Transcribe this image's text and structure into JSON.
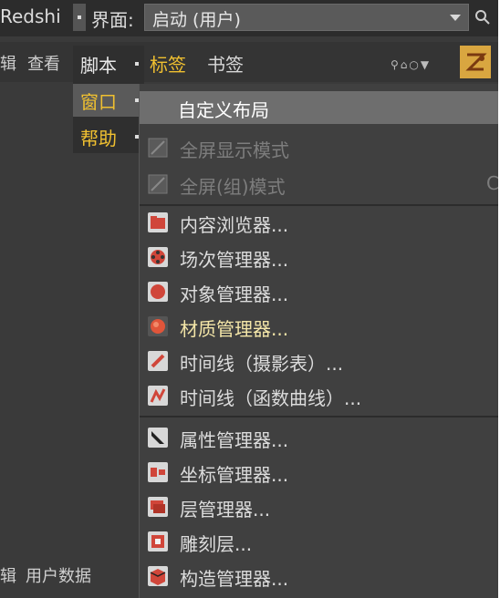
{
  "topbar": {
    "app_title": "Redshi",
    "interface_label": "界面:",
    "layout_value": "启动 (用户)"
  },
  "toolbar_row": {
    "left_items": [
      "辑",
      "查看"
    ],
    "tags": "标签",
    "bookmarks": "书签"
  },
  "submenu": {
    "items": [
      {
        "label": "脚本"
      },
      {
        "label": "窗口"
      },
      {
        "label": "帮助"
      }
    ]
  },
  "dropdown": {
    "custom_layout": "自定义布局",
    "fullscreen_mode": "全屏显示模式",
    "fullscreen_group_mode": "全屏(组)模式",
    "fullscreen_group_shortcut": "C",
    "content_browser": "内容浏览器...",
    "take_manager": "场次管理器...",
    "object_manager": "对象管理器...",
    "material_manager": "材质管理器...",
    "timeline_dopesheet": "时间线（摄影表）...",
    "timeline_fcurve": "时间线（函数曲线）...",
    "attribute_manager": "属性管理器...",
    "coordinate_manager": "坐标管理器...",
    "layer_manager": "层管理器...",
    "sculpt_layers": "雕刻层...",
    "construction_manager": "构造管理器..."
  },
  "bottom_left": {
    "items": [
      "辑",
      "用户数据"
    ]
  },
  "colors": {
    "accent": "#f0c030",
    "menu_bg": "#404040",
    "highlight": "#6e6e6e",
    "icon_red": "#d0463a"
  }
}
